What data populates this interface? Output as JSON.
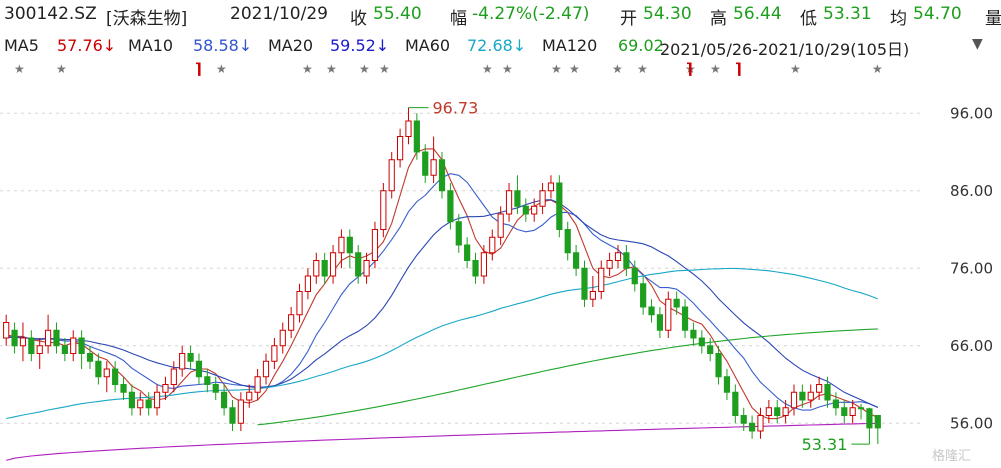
{
  "header": {
    "code": "300142.SZ",
    "name": "[沃森生物]",
    "date": "2021/10/29",
    "close_label": "收",
    "close": "55.40",
    "change_label": "幅",
    "change": "-4.27%(-2.47)",
    "open_label": "开",
    "open": "54.30",
    "high_label": "高",
    "high": "56.44",
    "low_label": "低",
    "low": "53.31",
    "avg_label": "均",
    "avg": "54.70",
    "trail": "量"
  },
  "ma_legend": [
    {
      "label": "MA5",
      "value": "57.76↓",
      "color": "#cc0000"
    },
    {
      "label": "MA10",
      "value": "58.58↓",
      "color": "#3355cc"
    },
    {
      "label": "MA20",
      "value": "59.52↓",
      "color": "#1a1acc"
    },
    {
      "label": "MA60",
      "value": "72.68↓",
      "color": "#19a7c7"
    },
    {
      "label": "MA120",
      "value": "69.02",
      "color": "#1e9e1e"
    }
  ],
  "range_text": "2021/05/26-2021/10/29(105日)",
  "watermark": "格隆汇",
  "colors": {
    "up": "#cc0000",
    "down": "#1e9e1e",
    "ma5": "#c0392b",
    "ma10": "#3a5fcd",
    "ma20": "#2b47b5",
    "ma60": "#19a7c7",
    "ma120": "#22a52d",
    "ma250": "#b01fbf"
  },
  "chart_data": {
    "type": "candlestick",
    "ylim": [
      51,
      99
    ],
    "y_ticks": [
      "96.00",
      "86.00",
      "76.00",
      "66.00",
      "56.00"
    ],
    "high_annotation": "96.73",
    "low_annotation": "53.31",
    "candles": [
      [
        67,
        69,
        66,
        70
      ],
      [
        68,
        66,
        65,
        69
      ],
      [
        66,
        67,
        64,
        69
      ],
      [
        67,
        65,
        64,
        68
      ],
      [
        65,
        66,
        63,
        67
      ],
      [
        66,
        68,
        65,
        70
      ],
      [
        68,
        66,
        65,
        69
      ],
      [
        66,
        65,
        64,
        67
      ],
      [
        65,
        67,
        64,
        68
      ],
      [
        67,
        65,
        63,
        68
      ],
      [
        65,
        64,
        63,
        66
      ],
      [
        64,
        62,
        61,
        65
      ],
      [
        62,
        63,
        60,
        64
      ],
      [
        63,
        61,
        60,
        64
      ],
      [
        61,
        60,
        59,
        62
      ],
      [
        60,
        58,
        57,
        61
      ],
      [
        58,
        59,
        57,
        60
      ],
      [
        59,
        58,
        57,
        60
      ],
      [
        58,
        60,
        57,
        61
      ],
      [
        60,
        61,
        59,
        62
      ],
      [
        61,
        63,
        60,
        64
      ],
      [
        63,
        65,
        62,
        66
      ],
      [
        65,
        64,
        63,
        66
      ],
      [
        64,
        62,
        61,
        65
      ],
      [
        62,
        61,
        60,
        63
      ],
      [
        61,
        60,
        59,
        62
      ],
      [
        60,
        58,
        57,
        61
      ],
      [
        58,
        56,
        55,
        59
      ],
      [
        56,
        59,
        55,
        60
      ],
      [
        59,
        60,
        58,
        61
      ],
      [
        60,
        62,
        59,
        63
      ],
      [
        62,
        64,
        61,
        65
      ],
      [
        64,
        66,
        63,
        67
      ],
      [
        66,
        68,
        65,
        69
      ],
      [
        68,
        70,
        67,
        71
      ],
      [
        70,
        73,
        69,
        74
      ],
      [
        73,
        75,
        72,
        76
      ],
      [
        75,
        77,
        74,
        78
      ],
      [
        77,
        75,
        74,
        78
      ],
      [
        75,
        78,
        74,
        79
      ],
      [
        78,
        80,
        76,
        81
      ],
      [
        80,
        78,
        76,
        81
      ],
      [
        78,
        75,
        74,
        79
      ],
      [
        75,
        77,
        74,
        78
      ],
      [
        77,
        81,
        76,
        82
      ],
      [
        81,
        86,
        80,
        87
      ],
      [
        86,
        90,
        85,
        91
      ],
      [
        90,
        93,
        89,
        94
      ],
      [
        93,
        95,
        92,
        96.73
      ],
      [
        95,
        91,
        90,
        96
      ],
      [
        91,
        88,
        87,
        92
      ],
      [
        88,
        90,
        87,
        93
      ],
      [
        90,
        86,
        85,
        91
      ],
      [
        86,
        82,
        81,
        87
      ],
      [
        82,
        79,
        78,
        83
      ],
      [
        79,
        77,
        76,
        80
      ],
      [
        77,
        75,
        74,
        78
      ],
      [
        75,
        78,
        74,
        79
      ],
      [
        78,
        80,
        77,
        81
      ],
      [
        80,
        83,
        79,
        84
      ],
      [
        83,
        86,
        82,
        87
      ],
      [
        86,
        84,
        83,
        88
      ],
      [
        84,
        83,
        82,
        85
      ],
      [
        83,
        84,
        82,
        85
      ],
      [
        84,
        86,
        83,
        87
      ],
      [
        86,
        87,
        85,
        88
      ],
      [
        87,
        81,
        80,
        88
      ],
      [
        81,
        78,
        77,
        82
      ],
      [
        78,
        76,
        75,
        79
      ],
      [
        76,
        72,
        71,
        77
      ],
      [
        72,
        73,
        71,
        75
      ],
      [
        73,
        76,
        72,
        77
      ],
      [
        76,
        77,
        75,
        78
      ],
      [
        77,
        78,
        76,
        79
      ],
      [
        78,
        76,
        75,
        79
      ],
      [
        76,
        74,
        73,
        77
      ],
      [
        74,
        71,
        70,
        75
      ],
      [
        71,
        70,
        69,
        72
      ],
      [
        70,
        68,
        67,
        71
      ],
      [
        68,
        72,
        67,
        73
      ],
      [
        72,
        71,
        70,
        73
      ],
      [
        71,
        68,
        67,
        72
      ],
      [
        68,
        67,
        66,
        69
      ],
      [
        67,
        66,
        65,
        68
      ],
      [
        66,
        65,
        64,
        67
      ],
      [
        65,
        62,
        61,
        66
      ],
      [
        62,
        60,
        59,
        63
      ],
      [
        60,
        57,
        56,
        61
      ],
      [
        57,
        56,
        55,
        58
      ],
      [
        56,
        55,
        54,
        57
      ],
      [
        55,
        57,
        54,
        58
      ],
      [
        57,
        58,
        56,
        59
      ],
      [
        58,
        57,
        56,
        59
      ],
      [
        57,
        58,
        56,
        59
      ],
      [
        58,
        60,
        57,
        61
      ],
      [
        60,
        59,
        58,
        61
      ],
      [
        59,
        60,
        58,
        61
      ],
      [
        60,
        61,
        59,
        62
      ],
      [
        61,
        59,
        58,
        62
      ],
      [
        59,
        58,
        57,
        60
      ],
      [
        58,
        57,
        56,
        59
      ],
      [
        57,
        58,
        56,
        59
      ],
      [
        58,
        57.87,
        56.5,
        58.5
      ],
      [
        57.87,
        55.4,
        53.31,
        58
      ],
      [
        57,
        55.4,
        53.31,
        56.44
      ]
    ]
  }
}
